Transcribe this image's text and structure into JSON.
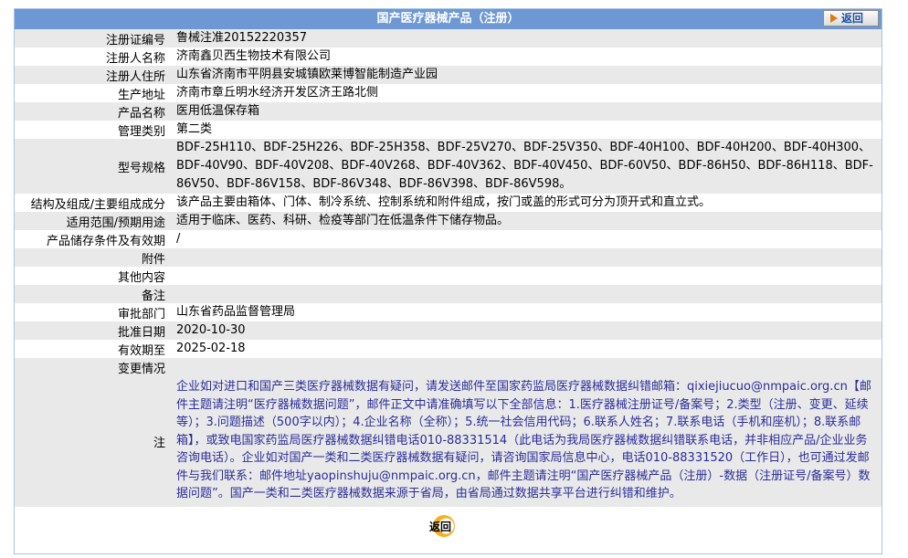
{
  "header": {
    "title": "国产医疗器械产品（注册）",
    "back_label": "返回"
  },
  "rows": [
    {
      "label": "注册证编号",
      "value": "鲁械注准20152220357"
    },
    {
      "label": "注册人名称",
      "value": "济南鑫贝西生物技术有限公司"
    },
    {
      "label": "注册人住所",
      "value": "山东省济南市平阴县安城镇欧莱博智能制造产业园"
    },
    {
      "label": "生产地址",
      "value": "济南市章丘明水经济开发区济王路北侧"
    },
    {
      "label": "产品名称",
      "value": "医用低温保存箱"
    },
    {
      "label": "管理类别",
      "value": "第二类"
    },
    {
      "label": "型号规格",
      "value": "BDF-25H110、BDF-25H226、BDF-25H358、BDF-25V270、BDF-25V350、BDF-40H100、BDF-40H200、BDF-40H300、BDF-40V90、BDF-40V208、BDF-40V268、BDF-40V362、BDF-40V450、BDF-60V50、BDF-86H50、BDF-86H118、BDF-86V50、BDF-86V158、BDF-86V348、BDF-86V398、BDF-86V598。"
    },
    {
      "label": "结构及组成/主要组成成分",
      "value": "该产品主要由箱体、门体、制冷系统、控制系统和附件组成，按门或盖的形式可分为顶开式和直立式。"
    },
    {
      "label": "适用范围/预期用途",
      "value": "适用于临床、医药、科研、检疫等部门在低温条件下储存物品。"
    },
    {
      "label": "产品储存条件及有效期",
      "value": "/"
    },
    {
      "label": "附件",
      "value": ""
    },
    {
      "label": "其他内容",
      "value": ""
    },
    {
      "label": "备注",
      "value": ""
    },
    {
      "label": "审批部门",
      "value": "山东省药品监督管理局"
    },
    {
      "label": "批准日期",
      "value": "2020-10-30"
    },
    {
      "label": "有效期至",
      "value": "2025-02-18"
    },
    {
      "label": "变更情况",
      "value": ""
    }
  ],
  "note": {
    "label": "注",
    "text": "企业如对进口和国产三类医疗器械数据有疑问，请发送邮件至国家药监局医疗器械数据纠错邮箱：qixiejiucuo@nmpaic.org.cn【邮件主题请注明“医疗器械数据问题”，邮件正文中请准确填写以下全部信息：1.医疗器械注册证号/备案号；2.类型（注册、变更、延续等）；3.问题描述（500字以内）；4.企业名称（全称）；5.统一社会信用代码；6.联系人姓名；7.联系电话（手机和座机）；8.联系邮箱】，或致电国家药监局医疗器械数据纠错电话010-88331514（此电话为我局医疗器械数据纠错联系电话，并非相应产品/企业业务咨询电话）。企业如对国产一类和二类医疗器械数据有疑问，请咨询国家局信息中心，电话010-88331520（工作日），也可通过发邮件与我们联系：邮件地址yaopinshuju@nmpaic.org.cn，邮件主题请注明“国产医疗器械产品（注册）-数据（注册证号/备案号）数据问题”。国产一类和二类医疗器械数据来源于省局，由省局通过数据共享平台进行纠错和维护。"
  },
  "footer": {
    "back_label": "返回"
  },
  "colors": {
    "header_bg": "#6d98d4",
    "alt_row_bg": "#e9e9e9",
    "note_text": "#2c2c9a",
    "back_icon": "#f4b11c"
  }
}
